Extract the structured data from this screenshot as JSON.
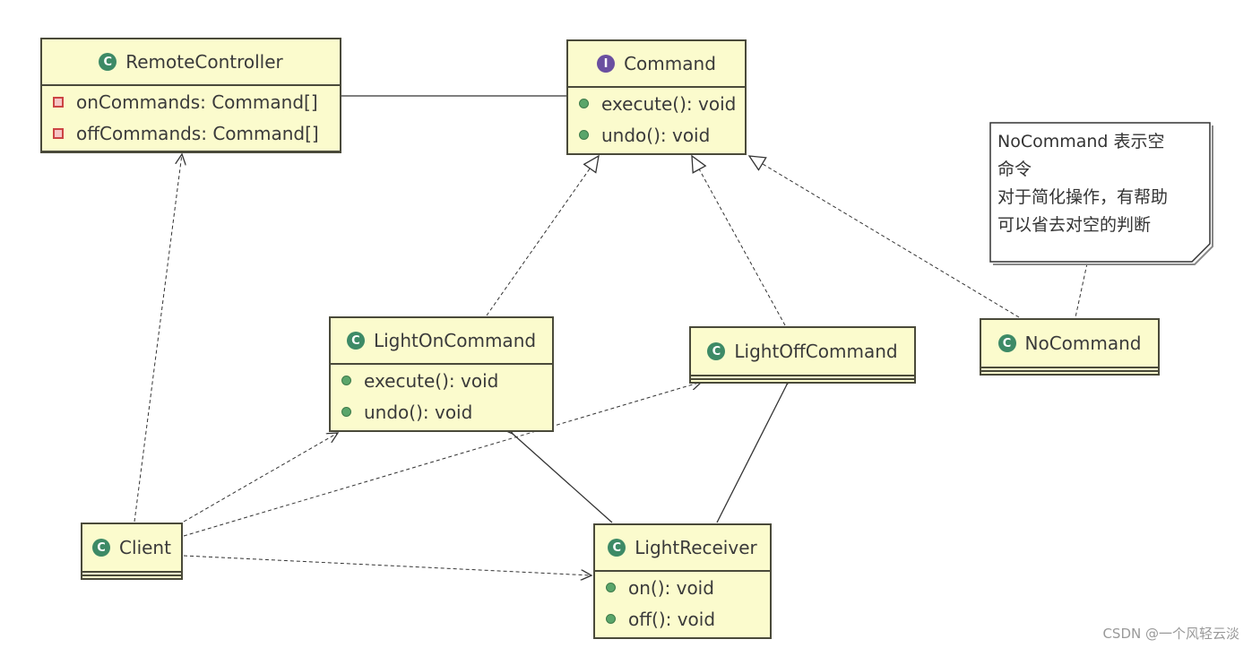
{
  "classes": {
    "remote": {
      "name": "RemoteController",
      "kind": "class",
      "attrs": [
        "onCommands: Command[]",
        "offCommands: Command[]"
      ]
    },
    "command": {
      "name": "Command",
      "kind": "interface",
      "methods": [
        "execute(): void",
        "undo(): void"
      ]
    },
    "lighton": {
      "name": "LightOnCommand",
      "kind": "class",
      "methods": [
        "execute(): void",
        "undo(): void"
      ]
    },
    "lightoff": {
      "name": "LightOffCommand",
      "kind": "class"
    },
    "nocommand": {
      "name": "NoCommand",
      "kind": "class"
    },
    "client": {
      "name": "Client",
      "kind": "class"
    },
    "receiver": {
      "name": "LightReceiver",
      "kind": "class",
      "methods": [
        "on(): void",
        "off(): void"
      ]
    }
  },
  "icons": {
    "class": "C",
    "interface": "I"
  },
  "note": {
    "lines": [
      "NoCommand 表示空",
      "命令",
      "对于简化操作，有帮助",
      "可以省去对空的判断"
    ]
  },
  "watermark": "CSDN @一个风轻云淡",
  "colors": {
    "class_fill": "#fbfbcd",
    "border": "#4a4a3a",
    "class_icon": "#3d8a66",
    "interface_icon": "#6a4fa0"
  }
}
